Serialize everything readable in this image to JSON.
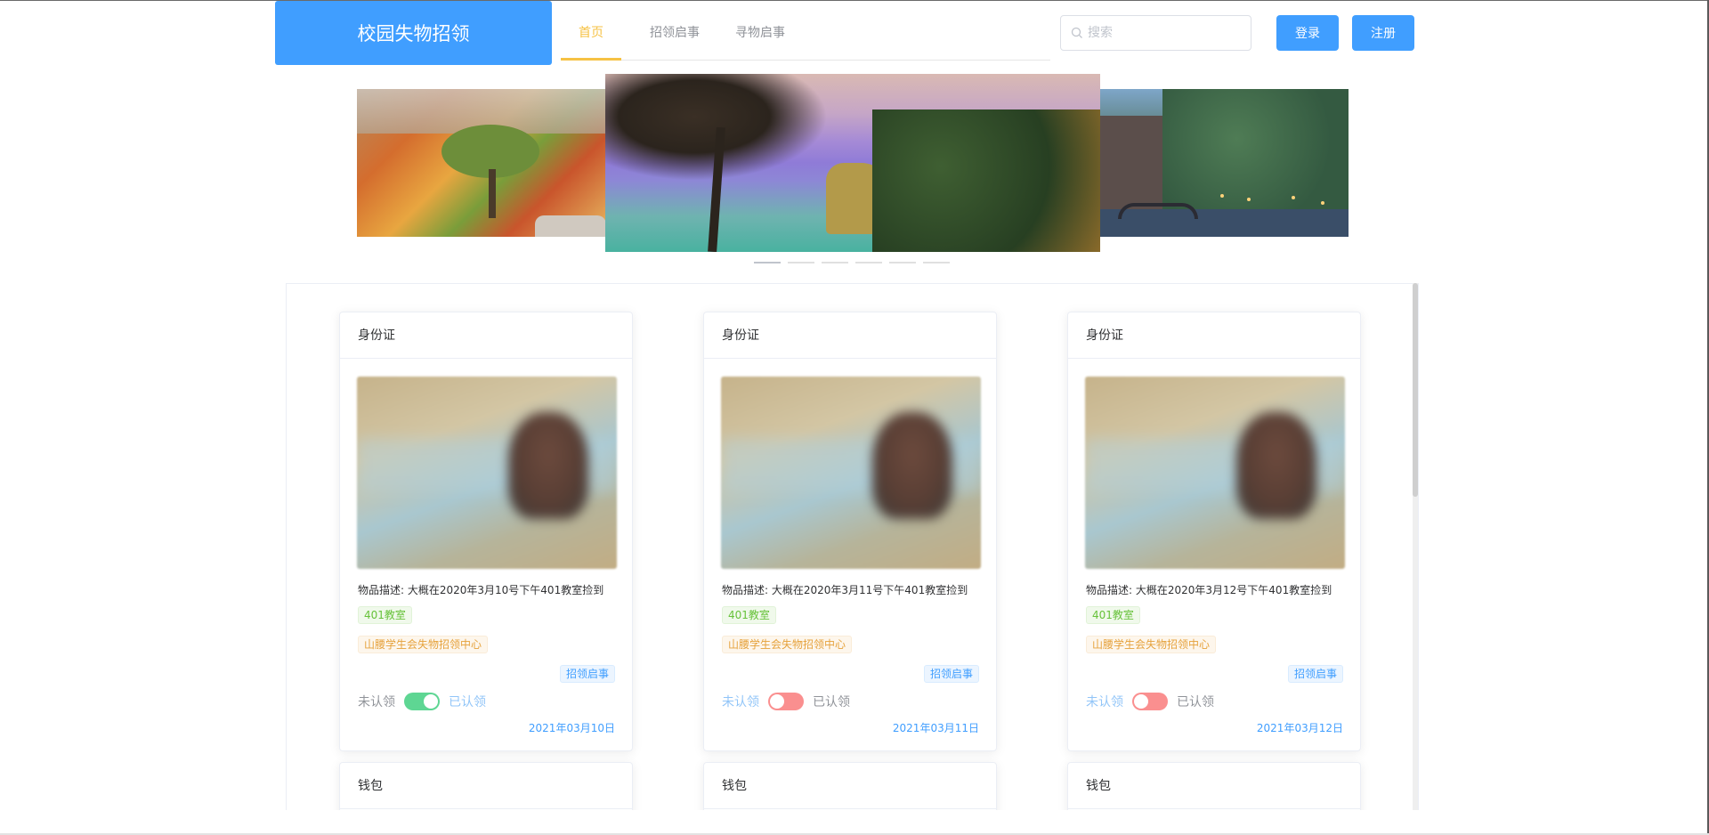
{
  "header": {
    "logo_text": "校园失物招领",
    "nav": [
      {
        "label": "首页",
        "active": true
      },
      {
        "label": "招领启事",
        "active": false
      },
      {
        "label": "寻物启事",
        "active": false
      }
    ],
    "search_placeholder": "搜索",
    "login_label": "登录",
    "register_label": "注册"
  },
  "carousel": {
    "slide_count": 6,
    "active_index": 0
  },
  "cards": [
    {
      "title": "身份证",
      "description": "物品描述: 大概在2020年3月10号下午401教室捡到",
      "location_tag": "401教室",
      "contact_tag": "山腰学生会失物招领中心",
      "type_tag": "招领启事",
      "switch_off_label": "未认领",
      "switch_on_label": "已认领",
      "claimed": true,
      "date": "2021年03月10日"
    },
    {
      "title": "身份证",
      "description": "物品描述: 大概在2020年3月11号下午401教室捡到",
      "location_tag": "401教室",
      "contact_tag": "山腰学生会失物招领中心",
      "type_tag": "招领启事",
      "switch_off_label": "未认领",
      "switch_on_label": "已认领",
      "claimed": false,
      "date": "2021年03月11日"
    },
    {
      "title": "身份证",
      "description": "物品描述: 大概在2020年3月12号下午401教室捡到",
      "location_tag": "401教室",
      "contact_tag": "山腰学生会失物招领中心",
      "type_tag": "招领启事",
      "switch_off_label": "未认领",
      "switch_on_label": "已认领",
      "claimed": false,
      "date": "2021年03月12日"
    }
  ],
  "next_row_titles": [
    "钱包",
    "钱包",
    "钱包"
  ],
  "colors": {
    "primary": "#409eff",
    "nav_active": "#f6c244",
    "switch_on": "#5ed693",
    "switch_off": "#fa8f8f"
  }
}
